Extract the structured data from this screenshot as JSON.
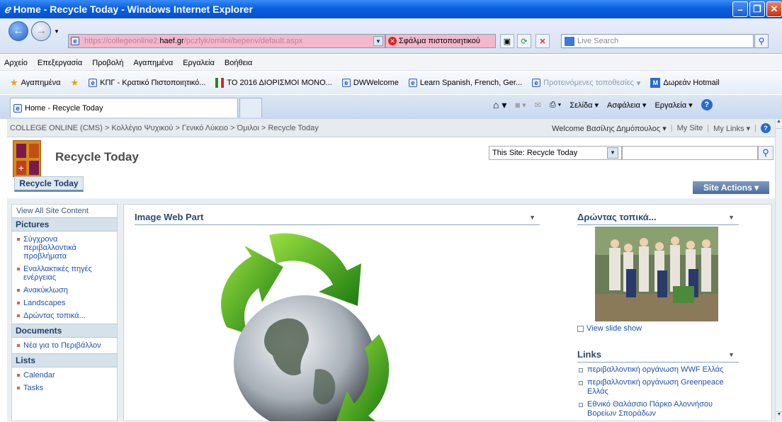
{
  "window": {
    "title": "Home - Recycle Today - Windows Internet Explorer"
  },
  "address": {
    "url_prefix": "https://collegeonline2.",
    "url_domain": "haef.gr",
    "url_suffix": "/pczfyk/omiloi/bepenv/default.aspx",
    "cert_error": "Σφάλμα πιστοποιητικού",
    "search_placeholder": "Live Search"
  },
  "menu": [
    "Αρχείο",
    "Επεξεργασία",
    "Προβολή",
    "Αγαπημένα",
    "Εργαλεία",
    "Βοήθεια"
  ],
  "favorites": {
    "label": "Αγαπημένα",
    "items": [
      "ΚΠΓ - Κρατικό Πιστοποιητικό...",
      "ΤΟ 2016 ΔΙΟΡΙΣΜΟΙ ΜΟΝΟ...",
      "DWWelcome",
      "Learn Spanish, French, Ger...",
      "Προτεινόμενες τοποθεσίες",
      "Δωρεάν Hotmail"
    ]
  },
  "tab": {
    "label": "Home - Recycle Today"
  },
  "commands": {
    "page": "Σελίδα",
    "safety": "Ασφάλεια",
    "tools": "Εργαλεία"
  },
  "sp": {
    "breadcrumb": "COLLEGE ONLINE (CMS) > Κολλέγιο Ψυχικού > Γενικό Λύκειο > Όμιλοι > Recycle Today",
    "welcome": "Welcome Βασίλης Δημόπουλος",
    "mysite": "My Site",
    "mylinks": "My Links",
    "site_title": "Recycle Today",
    "scope": "This Site: Recycle Today",
    "topnav": "Recycle Today",
    "site_actions": "Site Actions"
  },
  "quicklaunch": {
    "view_all": "View All Site Content",
    "pictures_head": "Pictures",
    "pictures": [
      "Σύγχρονα περιβαλλοντικά προβλήματα",
      "Εναλλακτικές πηγές ενέργειας",
      "Ανακύκλωση",
      "Landscapes",
      "Δρώντας τοπικά..."
    ],
    "documents_head": "Documents",
    "documents": [
      "Νέα για το Περιβάλλον"
    ],
    "lists_head": "Lists",
    "lists": [
      "Calendar",
      "Tasks"
    ]
  },
  "webparts": {
    "image_title": "Image Web Part",
    "slide_title": "Δρώντας τοπικά...",
    "view_slideshow": "View slide show",
    "links_title": "Links",
    "links": [
      "περιβαλλοντική οργάνωση WWF Ελλάς",
      "περιβαλλοντική οργάνωση Greenpeace Ελλάς",
      "Εθνικό Θαλάσσιο Πάρκο Αλοννήσου Βορείων Σποράδων"
    ]
  }
}
